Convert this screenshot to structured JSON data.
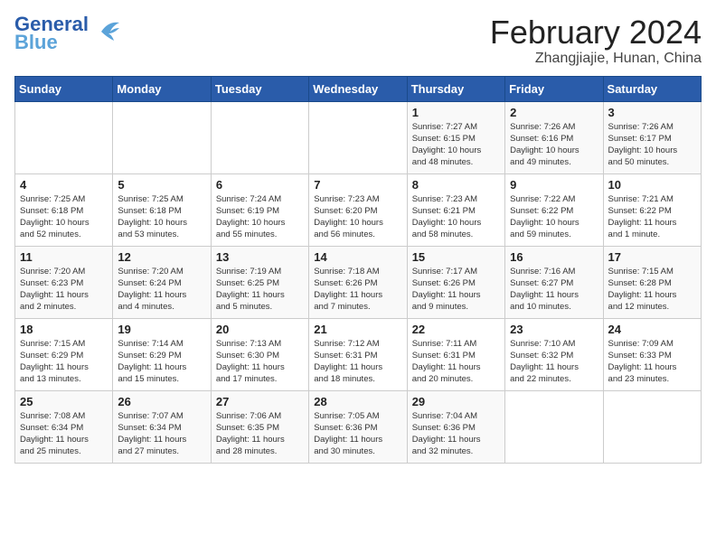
{
  "header": {
    "logo_line1": "General",
    "logo_line2": "Blue",
    "title": "February 2024",
    "subtitle": "Zhangjiajie, Hunan, China"
  },
  "days_of_week": [
    "Sunday",
    "Monday",
    "Tuesday",
    "Wednesday",
    "Thursday",
    "Friday",
    "Saturday"
  ],
  "weeks": [
    [
      {
        "day": "",
        "info": ""
      },
      {
        "day": "",
        "info": ""
      },
      {
        "day": "",
        "info": ""
      },
      {
        "day": "",
        "info": ""
      },
      {
        "day": "1",
        "info": "Sunrise: 7:27 AM\nSunset: 6:15 PM\nDaylight: 10 hours\nand 48 minutes."
      },
      {
        "day": "2",
        "info": "Sunrise: 7:26 AM\nSunset: 6:16 PM\nDaylight: 10 hours\nand 49 minutes."
      },
      {
        "day": "3",
        "info": "Sunrise: 7:26 AM\nSunset: 6:17 PM\nDaylight: 10 hours\nand 50 minutes."
      }
    ],
    [
      {
        "day": "4",
        "info": "Sunrise: 7:25 AM\nSunset: 6:18 PM\nDaylight: 10 hours\nand 52 minutes."
      },
      {
        "day": "5",
        "info": "Sunrise: 7:25 AM\nSunset: 6:18 PM\nDaylight: 10 hours\nand 53 minutes."
      },
      {
        "day": "6",
        "info": "Sunrise: 7:24 AM\nSunset: 6:19 PM\nDaylight: 10 hours\nand 55 minutes."
      },
      {
        "day": "7",
        "info": "Sunrise: 7:23 AM\nSunset: 6:20 PM\nDaylight: 10 hours\nand 56 minutes."
      },
      {
        "day": "8",
        "info": "Sunrise: 7:23 AM\nSunset: 6:21 PM\nDaylight: 10 hours\nand 58 minutes."
      },
      {
        "day": "9",
        "info": "Sunrise: 7:22 AM\nSunset: 6:22 PM\nDaylight: 10 hours\nand 59 minutes."
      },
      {
        "day": "10",
        "info": "Sunrise: 7:21 AM\nSunset: 6:22 PM\nDaylight: 11 hours\nand 1 minute."
      }
    ],
    [
      {
        "day": "11",
        "info": "Sunrise: 7:20 AM\nSunset: 6:23 PM\nDaylight: 11 hours\nand 2 minutes."
      },
      {
        "day": "12",
        "info": "Sunrise: 7:20 AM\nSunset: 6:24 PM\nDaylight: 11 hours\nand 4 minutes."
      },
      {
        "day": "13",
        "info": "Sunrise: 7:19 AM\nSunset: 6:25 PM\nDaylight: 11 hours\nand 5 minutes."
      },
      {
        "day": "14",
        "info": "Sunrise: 7:18 AM\nSunset: 6:26 PM\nDaylight: 11 hours\nand 7 minutes."
      },
      {
        "day": "15",
        "info": "Sunrise: 7:17 AM\nSunset: 6:26 PM\nDaylight: 11 hours\nand 9 minutes."
      },
      {
        "day": "16",
        "info": "Sunrise: 7:16 AM\nSunset: 6:27 PM\nDaylight: 11 hours\nand 10 minutes."
      },
      {
        "day": "17",
        "info": "Sunrise: 7:15 AM\nSunset: 6:28 PM\nDaylight: 11 hours\nand 12 minutes."
      }
    ],
    [
      {
        "day": "18",
        "info": "Sunrise: 7:15 AM\nSunset: 6:29 PM\nDaylight: 11 hours\nand 13 minutes."
      },
      {
        "day": "19",
        "info": "Sunrise: 7:14 AM\nSunset: 6:29 PM\nDaylight: 11 hours\nand 15 minutes."
      },
      {
        "day": "20",
        "info": "Sunrise: 7:13 AM\nSunset: 6:30 PM\nDaylight: 11 hours\nand 17 minutes."
      },
      {
        "day": "21",
        "info": "Sunrise: 7:12 AM\nSunset: 6:31 PM\nDaylight: 11 hours\nand 18 minutes."
      },
      {
        "day": "22",
        "info": "Sunrise: 7:11 AM\nSunset: 6:31 PM\nDaylight: 11 hours\nand 20 minutes."
      },
      {
        "day": "23",
        "info": "Sunrise: 7:10 AM\nSunset: 6:32 PM\nDaylight: 11 hours\nand 22 minutes."
      },
      {
        "day": "24",
        "info": "Sunrise: 7:09 AM\nSunset: 6:33 PM\nDaylight: 11 hours\nand 23 minutes."
      }
    ],
    [
      {
        "day": "25",
        "info": "Sunrise: 7:08 AM\nSunset: 6:34 PM\nDaylight: 11 hours\nand 25 minutes."
      },
      {
        "day": "26",
        "info": "Sunrise: 7:07 AM\nSunset: 6:34 PM\nDaylight: 11 hours\nand 27 minutes."
      },
      {
        "day": "27",
        "info": "Sunrise: 7:06 AM\nSunset: 6:35 PM\nDaylight: 11 hours\nand 28 minutes."
      },
      {
        "day": "28",
        "info": "Sunrise: 7:05 AM\nSunset: 6:36 PM\nDaylight: 11 hours\nand 30 minutes."
      },
      {
        "day": "29",
        "info": "Sunrise: 7:04 AM\nSunset: 6:36 PM\nDaylight: 11 hours\nand 32 minutes."
      },
      {
        "day": "",
        "info": ""
      },
      {
        "day": "",
        "info": ""
      }
    ]
  ]
}
